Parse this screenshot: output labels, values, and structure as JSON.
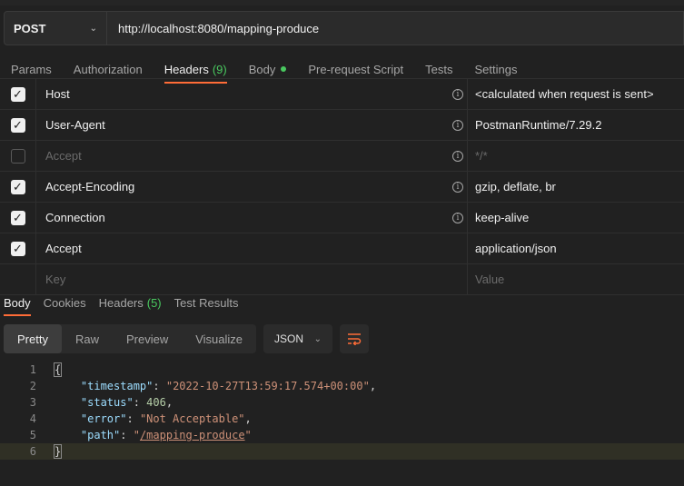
{
  "request": {
    "method": "POST",
    "url": "http://localhost:8080/mapping-produce"
  },
  "request_tabs": [
    {
      "label": "Params"
    },
    {
      "label": "Authorization"
    },
    {
      "label": "Headers",
      "count": "(9)",
      "active": true
    },
    {
      "label": "Body",
      "has_dot": true
    },
    {
      "label": "Pre-request Script"
    },
    {
      "label": "Tests"
    },
    {
      "label": "Settings"
    }
  ],
  "headers": [
    {
      "checked": true,
      "key": "Host",
      "value": "<calculated when request is sent>",
      "info": true
    },
    {
      "checked": true,
      "key": "User-Agent",
      "value": "PostmanRuntime/7.29.2",
      "info": true
    },
    {
      "checked": false,
      "key": "Accept",
      "value": "*/*",
      "info": true
    },
    {
      "checked": true,
      "key": "Accept-Encoding",
      "value": "gzip, deflate, br",
      "info": true
    },
    {
      "checked": true,
      "key": "Connection",
      "value": "keep-alive",
      "info": true
    },
    {
      "checked": true,
      "key": "Accept",
      "value": "application/json",
      "info": false
    }
  ],
  "header_placeholder": {
    "key": "Key",
    "value": "Value"
  },
  "response_tabs": [
    {
      "label": "Body",
      "active": true
    },
    {
      "label": "Cookies"
    },
    {
      "label": "Headers",
      "count": "(5)"
    },
    {
      "label": "Test Results"
    }
  ],
  "view_modes": [
    "Pretty",
    "Raw",
    "Preview",
    "Visualize"
  ],
  "active_view": "Pretty",
  "language": "JSON",
  "code_lines": [
    "1",
    "2",
    "3",
    "4",
    "5",
    "6"
  ],
  "response_json": {
    "timestamp_key": "\"timestamp\"",
    "timestamp_val": "\"2022-10-27T13:59:17.574+00:00\"",
    "status_key": "\"status\"",
    "status_val": "406",
    "error_key": "\"error\"",
    "error_val": "\"Not Acceptable\"",
    "path_key": "\"path\"",
    "path_val": "/mapping-produce"
  },
  "colors": {
    "accent": "#ff6c37",
    "green": "#49c85f",
    "background": "#212121"
  }
}
